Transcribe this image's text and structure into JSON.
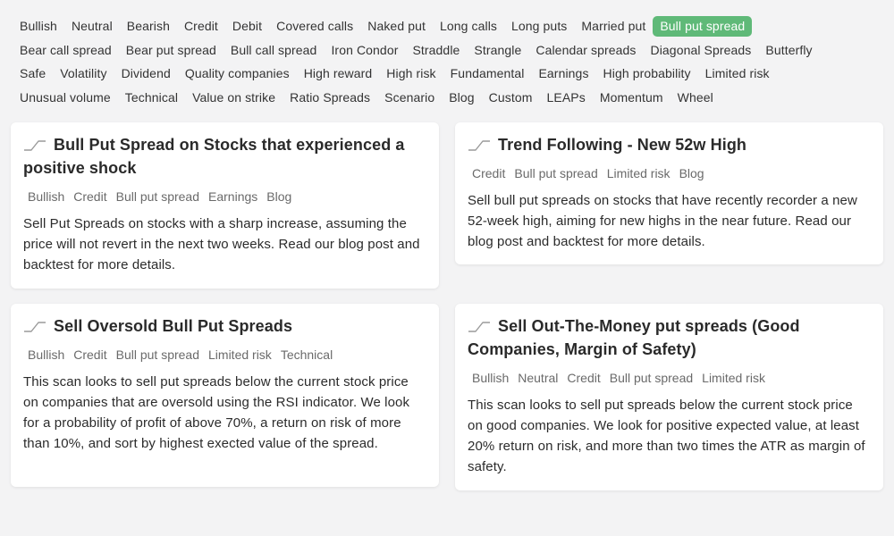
{
  "filters": {
    "rows": [
      [
        "Bullish",
        "Neutral",
        "Bearish",
        "Credit",
        "Debit",
        "Covered calls",
        "Naked put",
        "Long calls",
        "Long puts",
        "Married put",
        "Bull put spread"
      ],
      [
        "Bear call spread",
        "Bear put spread",
        "Bull call spread",
        "Iron Condor",
        "Straddle",
        "Strangle",
        "Calendar spreads",
        "Diagonal Spreads",
        "Butterfly"
      ],
      [
        "Safe",
        "Volatility",
        "Dividend",
        "Quality companies",
        "High reward",
        "High risk",
        "Fundamental",
        "Earnings",
        "High probability",
        "Limited risk"
      ],
      [
        "Unusual volume",
        "Technical",
        "Value on strike",
        "Ratio Spreads",
        "Scenario",
        "Blog",
        "Custom",
        "LEAPs",
        "Momentum",
        "Wheel"
      ]
    ],
    "active": "Bull put spread"
  },
  "cards": [
    {
      "id": "card1",
      "icon": "trend-line-icon",
      "title": "Bull Put Spread on Stocks that experienced a positive shock",
      "tags": [
        "Bullish",
        "Credit",
        "Bull put spread",
        "Earnings",
        "Blog"
      ],
      "description": "Sell Put Spreads on stocks with a sharp increase, assuming the price will not revert in the next two weeks. Read our blog post and backtest for more details."
    },
    {
      "id": "card2",
      "icon": "trend-line-icon",
      "title": "Trend Following - New 52w High",
      "tags": [
        "Credit",
        "Bull put spread",
        "Limited risk",
        "Blog"
      ],
      "description": "Sell bull put spreads on stocks that have recently recorder a new 52-week high, aiming for new highs in the near future. Read our blog post and backtest for more details."
    },
    {
      "id": "card3",
      "icon": "trend-line-icon",
      "title": "Sell Oversold Bull Put Spreads",
      "tags": [
        "Bullish",
        "Credit",
        "Bull put spread",
        "Limited risk",
        "Technical"
      ],
      "description": "This scan looks to sell put spreads below the current stock price on companies that are oversold using the RSI indicator. We look for a probability of profit of above 70%, a return on risk of more than 10%, and sort by highest exected value of the spread."
    },
    {
      "id": "card4",
      "icon": "trend-line-icon",
      "title": "Sell Out-The-Money put spreads (Good Companies, Margin of Safety)",
      "tags": [
        "Bullish",
        "Neutral",
        "Credit",
        "Bull put spread",
        "Limited risk"
      ],
      "description": "This scan looks to sell put spreads below the current stock price on good companies. We look for positive expected value, at least 20% return on risk, and more than two times the ATR as margin of safety."
    }
  ],
  "colors": {
    "active_tag_bg": "#5fb978",
    "page_bg": "#f3f3f4",
    "card_bg": "#ffffff"
  }
}
